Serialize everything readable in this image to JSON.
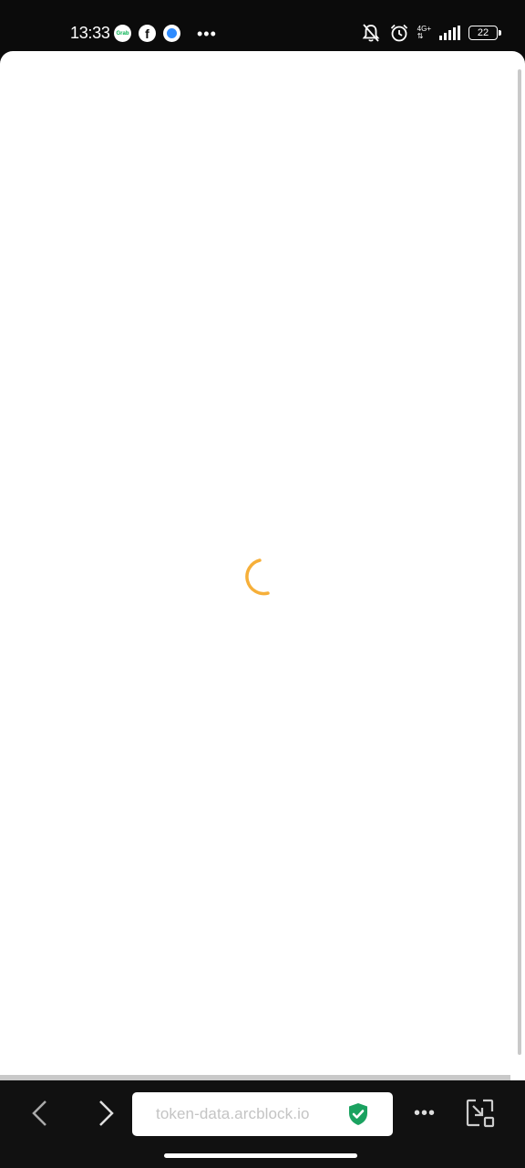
{
  "status_bar": {
    "time": "13:33",
    "notification_icons": [
      "grab-icon",
      "facebook-icon",
      "messenger-icon"
    ],
    "network_type": "4G+",
    "battery_level": "22"
  },
  "page": {
    "loading": true,
    "spinner_color": "#f5a623",
    "background": "#ffffff"
  },
  "browser_bar": {
    "url": "token-data.arcblock.io",
    "secure": true,
    "secure_color": "#1aa260"
  }
}
